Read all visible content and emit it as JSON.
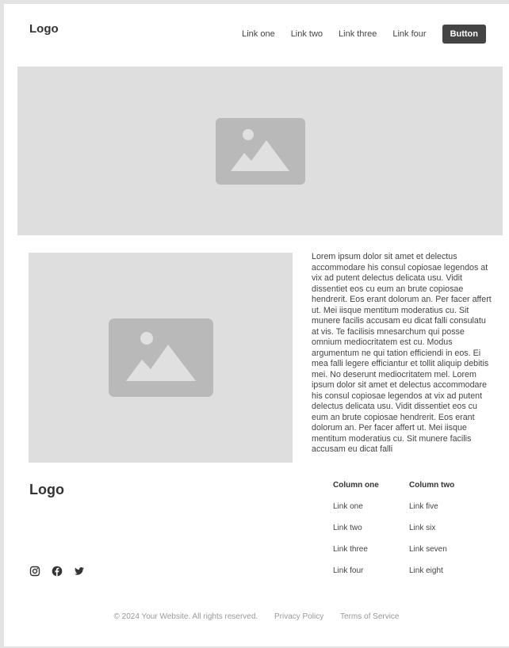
{
  "header": {
    "logo": "Logo",
    "nav_links": [
      "Link one",
      "Link two",
      "Link three",
      "Link four"
    ],
    "button_label": "Button"
  },
  "content": {
    "paragraph": "Lorem ipsum dolor sit amet et delectus accommodare his consul copiosae legendos at vix ad putent delectus delicata usu. Vidit dissentiet eos cu eum an brute copiosae hendrerit. Eos erant dolorum an. Per facer affert ut. Mei iisque mentitum moderatius cu. Sit munere facilis accusam eu dicat falli consulatu at vis. Te facilisis mnesarchum qui posse omnium mediocritatem est cu. Modus argumentum ne qui tation efficiendi in eos. Ei mea falli legere efficiantur et tollit aliquip debitis mei. No deserunt mediocritatem mel. Lorem ipsum dolor sit amet et delectus accommodare his consul copiosae legendos at vix ad putent delectus delicata usu. Vidit dissentiet eos cu eum an brute copiosae hendrerit. Eos erant dolorum an. Per facer affert ut. Mei iisque mentitum moderatius cu. Sit munere facilis accusam eu dicat falli"
  },
  "footer": {
    "logo": "Logo",
    "social_icons": [
      "instagram-icon",
      "facebook-icon",
      "twitter-icon"
    ],
    "columns": [
      {
        "title": "Column one",
        "links": [
          "Link one",
          "Link two",
          "Link three",
          "Link four"
        ]
      },
      {
        "title": "Column two",
        "links": [
          "Link five",
          "Link six",
          "Link seven",
          "Link eight"
        ]
      }
    ],
    "copyright": "© 2024 Your Website. All rights reserved.",
    "privacy": "Privacy Policy",
    "terms": "Terms of Service"
  },
  "colors": {
    "placeholder_bg": "#dedede",
    "placeholder_icon": "#b9b9b9",
    "button_bg": "#444444"
  }
}
